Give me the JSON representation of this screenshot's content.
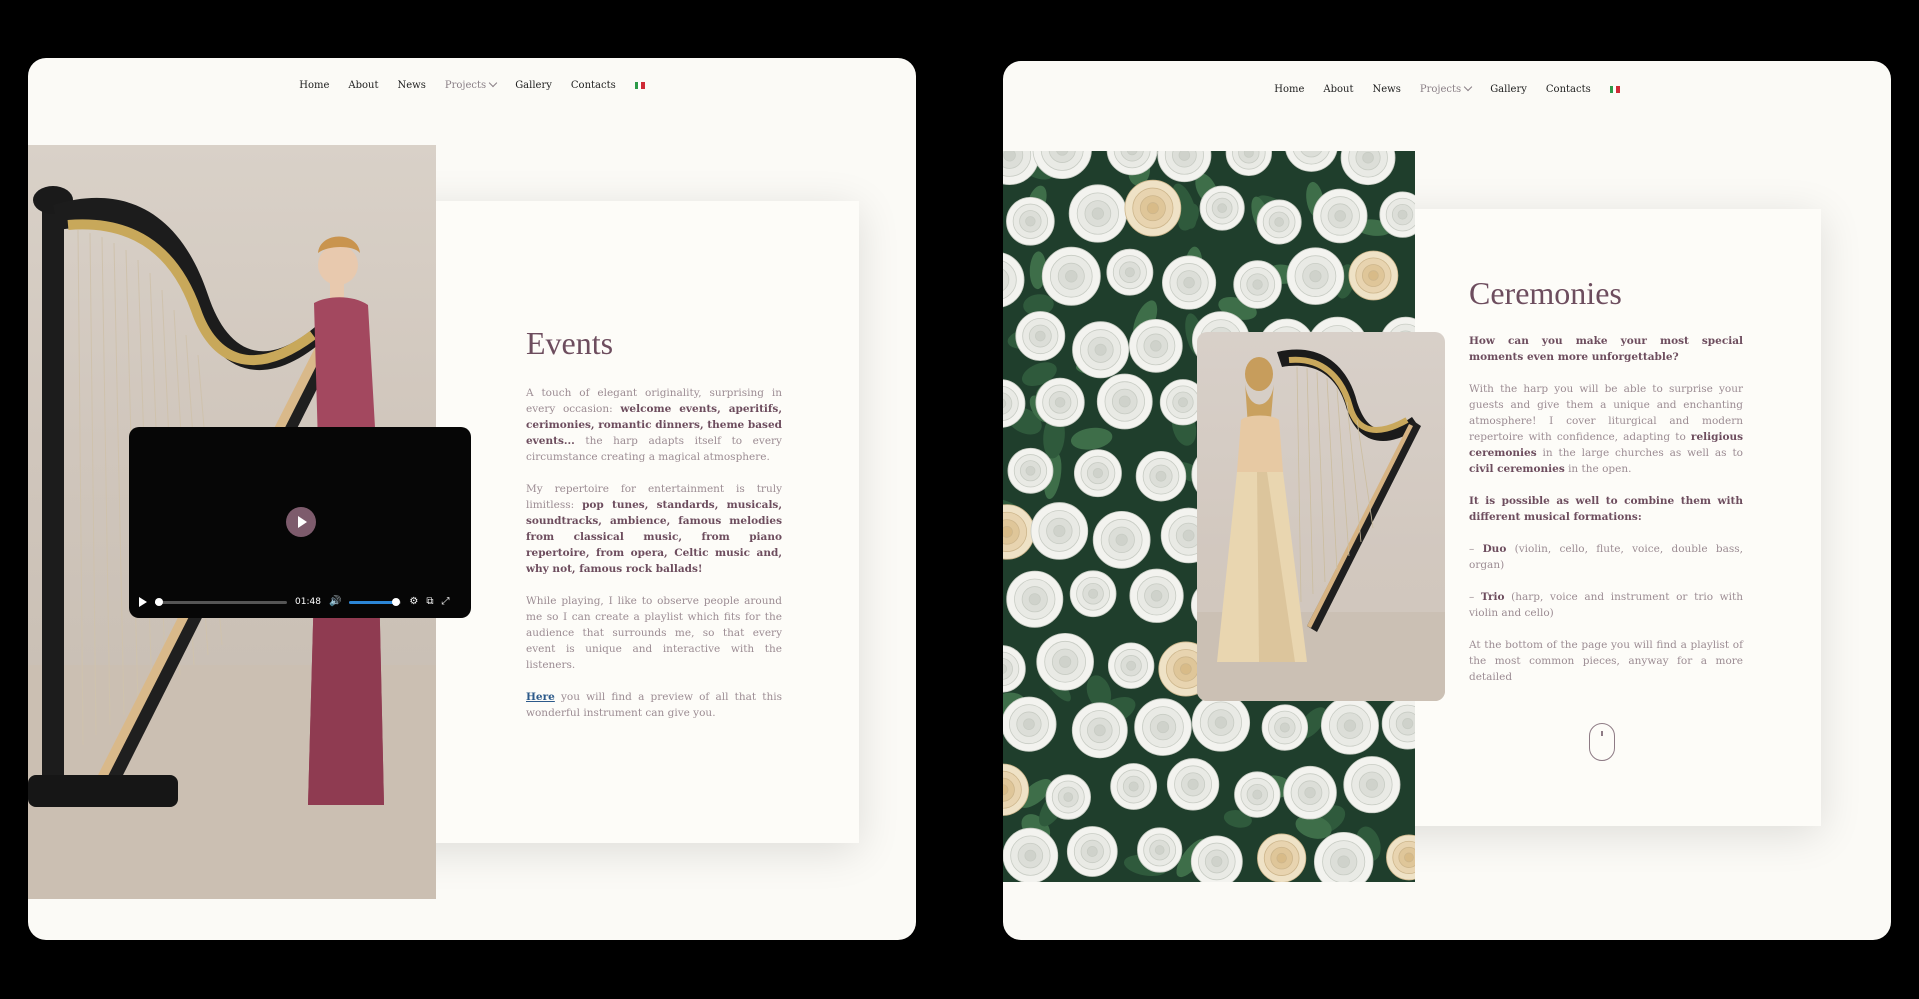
{
  "nav": {
    "items": [
      "Home",
      "About",
      "News",
      "Projects",
      "Gallery",
      "Contacts"
    ],
    "projects_index": 3,
    "language_flag": "italy-flag",
    "flag_colors": [
      "#2c9a48",
      "#ffffff",
      "#cf2a36"
    ]
  },
  "events": {
    "title": "Events",
    "p1": {
      "a": "A touch of elegant originality, surprising in every occasion: ",
      "b": "welcome events, aperitifs, cerimonies, romantic dinners, theme based events...",
      "c": " the harp adapts itself to every circumstance creating a magical atmosphere."
    },
    "p2": {
      "a": "My repertoire for entertainment is truly limitless: ",
      "b": "pop tunes, standards, musicals, soundtracks, ambience, famous melodies from classical music, from piano repertoire, from opera, Celtic music and, why not, famous rock ballads!"
    },
    "p3": "While playing, I like to observe people around me so I can create a playlist which fits for the audience that surrounds me, so that every event is unique and interactive with the listeners.",
    "p4": {
      "link": "Here",
      "rest": " you will find a preview of all that this wonderful instrument can give you."
    }
  },
  "video": {
    "time": "01:48",
    "progress": 0.03,
    "volume": 0.9
  },
  "ceremonies": {
    "title": "Ceremonies",
    "q": "How can you make your most special moments even more unforgettable?",
    "p1": {
      "a": "With the harp you will be able to surprise your guests and give them a unique and enchanting atmosphere! I cover liturgical and modern repertoire with confidence, adapting to ",
      "b": "religious ceremonies",
      "c": " in the large churches as well as to ",
      "d": "civil ceremonies",
      "e": " in the open."
    },
    "p2": "It is possible as well to combine them with different musical formations:",
    "duo": {
      "label": "Duo",
      "rest": " (violin, cello, flute, voice, double bass, organ)",
      "dash": "– "
    },
    "trio": {
      "label": "Trio",
      "rest": " (harp, voice and instrument or trio with violin and cello)",
      "dash": "– "
    },
    "p3": "At the bottom of the page you will find a playlist of the most common pieces, anyway for a more detailed"
  },
  "colors": {
    "accent": "#6d4d5e",
    "body_text": "#9c8c93",
    "link": "#2d5a8a",
    "play_button": "#7d5b6c",
    "volume": "#2c86d6"
  }
}
